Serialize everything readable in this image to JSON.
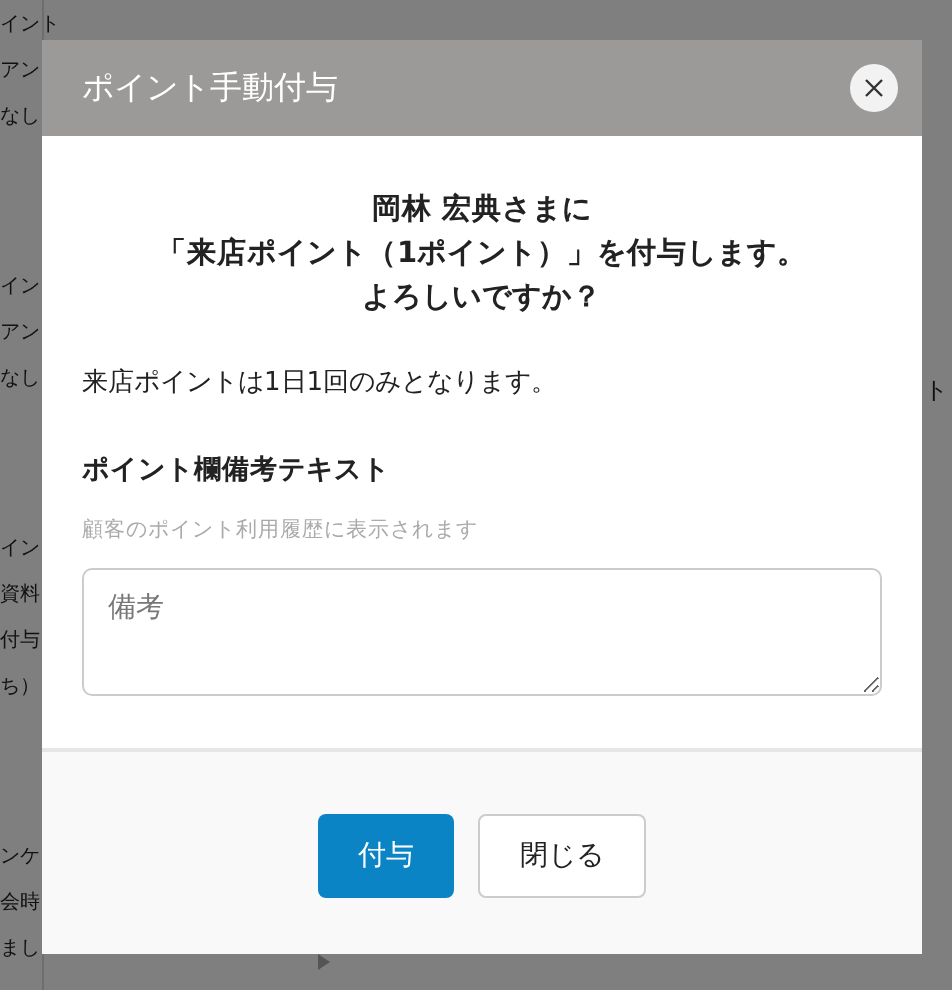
{
  "background": {
    "left_groups": [
      [
        "イント",
        "アン",
        "なし"
      ],
      [
        "イン",
        "アン",
        "なし"
      ],
      [
        "イン",
        "資料",
        "付与",
        "ち）"
      ],
      [
        "ンケ",
        "会時",
        "まし"
      ]
    ],
    "right_fragments": [
      "ト"
    ]
  },
  "dialog": {
    "title": "ポイント手動付与",
    "confirm_lines": [
      "岡林 宏典さまに",
      "「来店ポイント（1ポイント）」を付与します。",
      "よろしいですか？"
    ],
    "note": "来店ポイントは1日1回のみとなります。",
    "field_label": "ポイント欄備考テキスト",
    "field_help": "顧客のポイント利用履歴に表示されます",
    "field_placeholder": "備考",
    "buttons": [
      {
        "label": "付与",
        "kind": "primary"
      },
      {
        "label": "閉じる",
        "kind": "secondary"
      }
    ]
  }
}
